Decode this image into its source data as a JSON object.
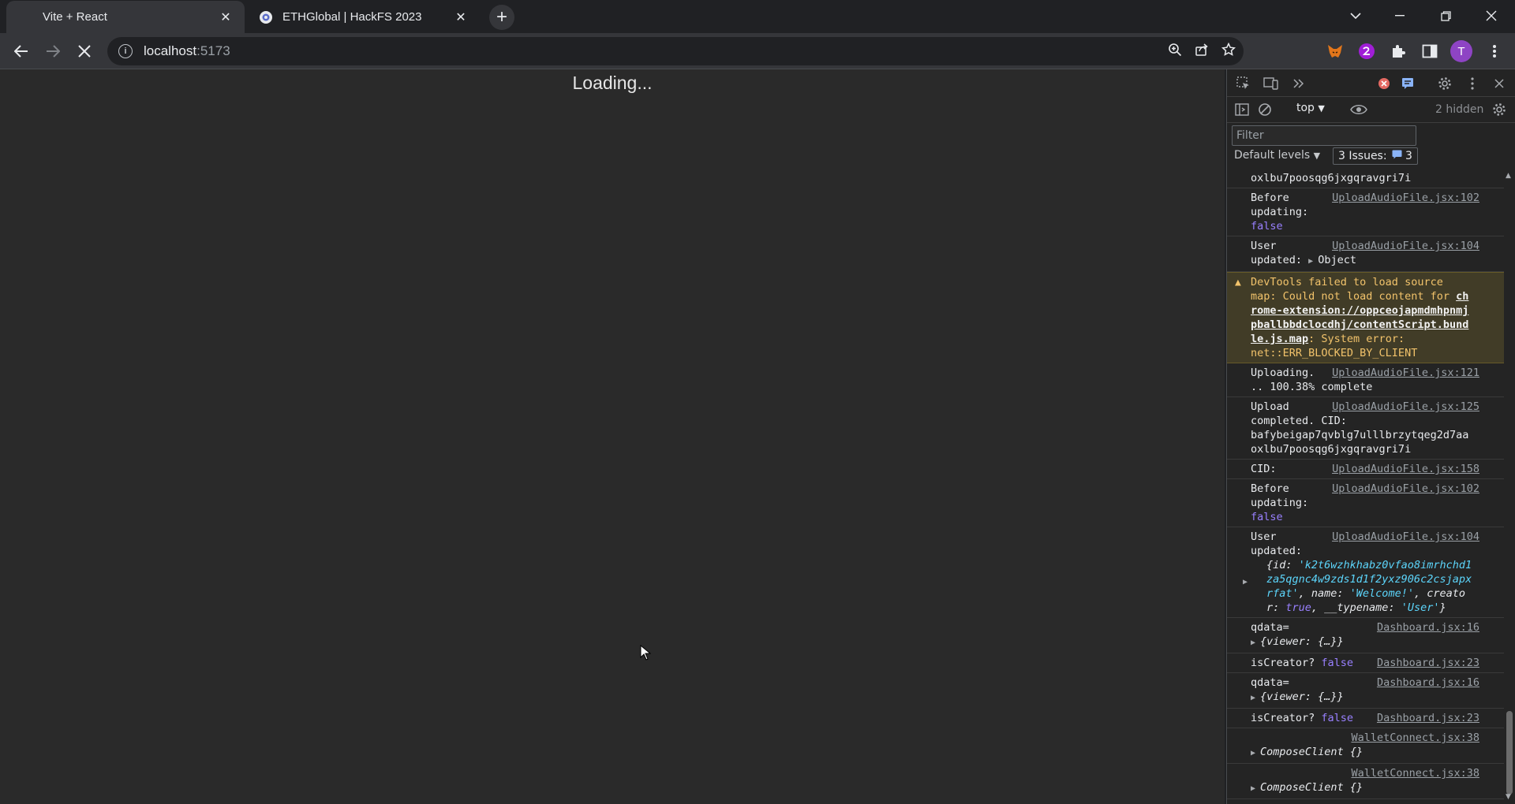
{
  "browser": {
    "tabs": [
      {
        "title": "Vite + React",
        "active": true
      },
      {
        "title": "ETHGlobal | HackFS 2023",
        "active": false
      }
    ],
    "url_host": "localhost",
    "url_port": ":5173",
    "profile_initial": "T"
  },
  "page": {
    "loading_text": "Loading..."
  },
  "devtools": {
    "context": "top",
    "hidden_count": "2 hidden",
    "filter_placeholder": "Filter",
    "levels_label": "Default levels",
    "issues_label": "3 Issues:",
    "issues_count": "3",
    "messages": {
      "m0": {
        "text": "oxlbu7poosqg6jxgqravgri7i"
      },
      "m1": {
        "label1": "Before",
        "label2": "updating:",
        "value": "false",
        "src": "UploadAudioFile.jsx:102"
      },
      "m2": {
        "label1": "User",
        "label2": "updated:",
        "value": "Object",
        "src": "UploadAudioFile.jsx:104"
      },
      "m3": {
        "line1": "DevTools failed to load source",
        "line2": "map: Could not load content for ",
        "link1": "ch",
        "link2": "rome-extension://oppceojapmdmhpnmj",
        "link3": "pballbbdclocdhj/contentScript.bund",
        "link4": "le.js.map",
        "line5": ": System error:",
        "line6": "net::ERR_BLOCKED_BY_CLIENT"
      },
      "m4": {
        "line1": "Uploading.",
        "line2": ".. 100.38% complete",
        "src": "UploadAudioFile.jsx:121"
      },
      "m5": {
        "line1": "Upload",
        "line2": "completed. CID:",
        "line3": "bafybeigap7qvblg7ulllbrzytqeg2d7aa",
        "line4": "oxlbu7poosqg6jxgqravgri7i",
        "src": "UploadAudioFile.jsx:125"
      },
      "m6": {
        "line1": "CID:",
        "src": "UploadAudioFile.jsx:158"
      },
      "m7": {
        "label1": "Before",
        "label2": "updating:",
        "value": "false",
        "src": "UploadAudioFile.jsx:102"
      },
      "m8": {
        "label1": "User",
        "label2": "updated:",
        "src": "UploadAudioFile.jsx:104",
        "o1": "{id: ",
        "o2": "'k2t6wzhkhabz0vfao8imrhchd1",
        "o3": "za5qgnc4w9zds1d1f2yxz906c2csjapx",
        "o4": "rfat'",
        "o5": ", name: ",
        "o6": "'Welcome!'",
        "o7": ", creato",
        "o8": "r: ",
        "o9": "true",
        "o10": ", __typename: ",
        "o11": "'User'",
        "o12": "}"
      },
      "m9": {
        "label1": "qdata=",
        "obj": "{viewer: {…}}",
        "src": "Dashboard.jsx:16"
      },
      "m10": {
        "label1": "isCreator?",
        "value": "false",
        "src": "Dashboard.jsx:23"
      },
      "m11": {
        "label1": "qdata=",
        "obj": "{viewer: {…}}",
        "src": "Dashboard.jsx:16"
      },
      "m12": {
        "label1": "isCreator?",
        "value": "false",
        "src": "Dashboard.jsx:23"
      },
      "m13": {
        "obj": "ComposeClient {}",
        "src": "WalletConnect.jsx:38"
      },
      "m14": {
        "obj": "ComposeClient {}",
        "src": "WalletConnect.jsx:38"
      }
    }
  },
  "colors": {
    "accent_profile": "#8e44c4",
    "warning_bg": "#413c27",
    "keyword": "#9980ff",
    "string": "#5cd5fb"
  }
}
